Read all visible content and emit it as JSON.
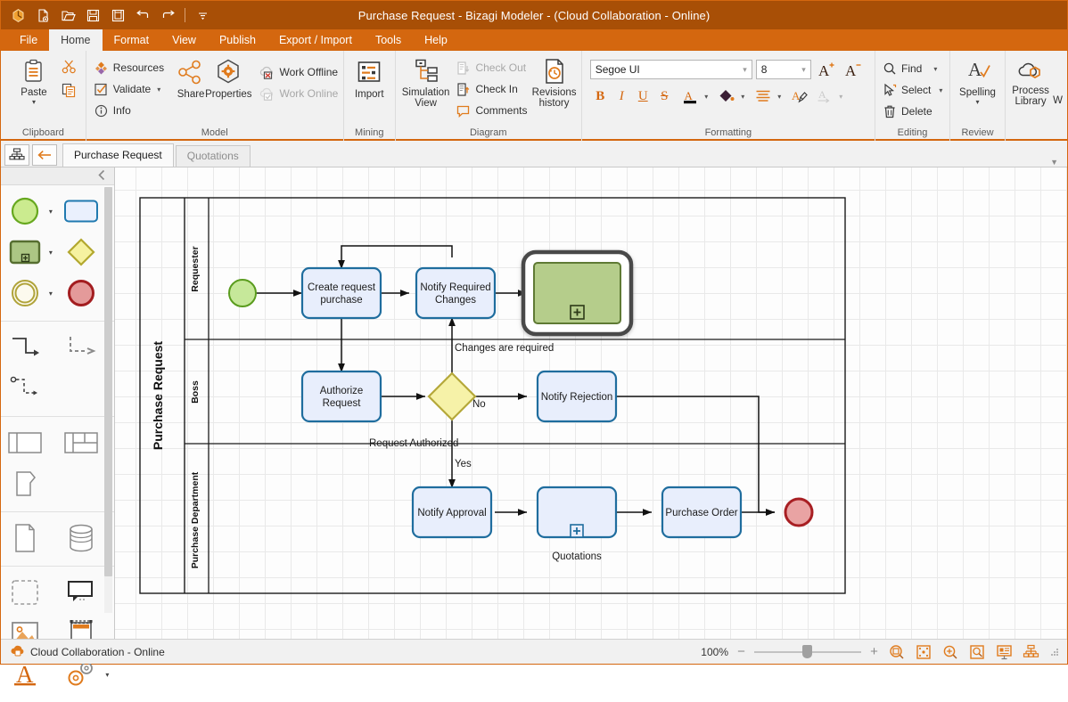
{
  "window": {
    "title": "Purchase Request - Bizagi Modeler - (Cloud Collaboration - Online)"
  },
  "quick_access": [
    {
      "name": "app-logo-icon",
      "tip": "Bizagi"
    },
    {
      "name": "new-document-icon",
      "tip": "New"
    },
    {
      "name": "open-folder-icon",
      "tip": "Open"
    },
    {
      "name": "save-icon",
      "tip": "Save"
    },
    {
      "name": "save-as-icon",
      "tip": "Save As"
    },
    {
      "name": "undo-icon",
      "tip": "Undo"
    },
    {
      "name": "redo-icon",
      "tip": "Redo"
    },
    {
      "name": "customize-qat-icon",
      "tip": "Customize Quick Access Toolbar"
    }
  ],
  "menu": {
    "tabs": [
      {
        "label": "File",
        "active": false
      },
      {
        "label": "Home",
        "active": true
      },
      {
        "label": "Format",
        "active": false
      },
      {
        "label": "View",
        "active": false
      },
      {
        "label": "Publish",
        "active": false
      },
      {
        "label": "Export / Import",
        "active": false
      },
      {
        "label": "Tools",
        "active": false
      },
      {
        "label": "Help",
        "active": false
      }
    ]
  },
  "ribbon": {
    "groups": {
      "clipboard": {
        "title": "Clipboard",
        "paste": "Paste",
        "cut": "Cut",
        "copy": "Copy"
      },
      "model": {
        "title": "Model",
        "resources": "Resources",
        "validate": "Validate",
        "info": "Info",
        "share": "Share",
        "properties": "Properties",
        "work_offline": "Work Offline",
        "work_online": "Work Online"
      },
      "mining": {
        "title": "Mining",
        "import": "Import"
      },
      "diagram": {
        "title": "Diagram",
        "simulation_view": "Simulation\nView",
        "simulation_view_line1": "Simulation",
        "simulation_view_line2": "View",
        "check_out": "Check Out",
        "check_in": "Check In",
        "comments": "Comments",
        "revisions_line1": "Revisions",
        "revisions_line2": "history"
      },
      "formatting": {
        "title": "Formatting",
        "font_family_value": "Segoe UI",
        "font_size_value": "8",
        "grow_font": "Increase font size",
        "shrink_font": "Decrease font size",
        "bold": "B",
        "italic": "I",
        "underline": "U",
        "strikethrough": "S",
        "font_color": "Font color",
        "fill_color": "Fill color",
        "align": "Align",
        "format_painter": "Format painter",
        "clear_format": "Clear format"
      },
      "editing": {
        "title": "Editing",
        "find": "Find",
        "select": "Select",
        "delete": "Delete"
      },
      "review": {
        "title": "Review",
        "spelling": "Spelling"
      },
      "collaboration": {
        "process_library_line1": "Process",
        "process_library_line2": "Library",
        "truncated": "W"
      }
    }
  },
  "document_tabs": {
    "diagram_selector_icon": "org-chart-icon",
    "back_icon": "back-arrow-icon",
    "tabs": [
      {
        "label": "Purchase Request",
        "active": true
      },
      {
        "label": "Quotations",
        "active": false
      }
    ]
  },
  "palette": {
    "collapse_icon": "chevron-left-icon",
    "items": [
      {
        "name": "start-event-shape",
        "label": "Start event",
        "has_dropdown": true
      },
      {
        "name": "task-shape",
        "label": "Task",
        "has_dropdown": true
      },
      {
        "name": "subprocess-shape",
        "label": "Sub-process",
        "has_dropdown": true
      },
      {
        "name": "gateway-shape",
        "label": "Gateway",
        "has_dropdown": true
      },
      {
        "name": "intermediate-event-shape",
        "label": "Intermediate event",
        "has_dropdown": true
      },
      {
        "name": "end-event-shape",
        "label": "End event",
        "has_dropdown": true
      },
      {
        "name": "sequence-flow-connector",
        "label": "Sequence flow",
        "has_dropdown": false
      },
      {
        "name": "message-flow-connector",
        "label": "Message flow",
        "has_dropdown": false
      },
      {
        "name": "association-connector",
        "label": "Association",
        "has_dropdown": false
      },
      {
        "name": "pool-shape",
        "label": "Pool",
        "has_dropdown": false
      },
      {
        "name": "lane-shape",
        "label": "Lane",
        "has_dropdown": false
      },
      {
        "name": "milestone-shape",
        "label": "Milestone",
        "has_dropdown": false
      },
      {
        "name": "data-object-shape",
        "label": "Data object",
        "has_dropdown": false
      },
      {
        "name": "data-store-shape",
        "label": "Data store",
        "has_dropdown": false
      },
      {
        "name": "group-shape",
        "label": "Group",
        "has_dropdown": false
      },
      {
        "name": "annotation-shape",
        "label": "Annotation",
        "has_dropdown": false
      },
      {
        "name": "image-shape",
        "label": "Image",
        "has_dropdown": false
      },
      {
        "name": "artifact-shape",
        "label": "Artifact",
        "has_dropdown": false
      },
      {
        "name": "text-tool",
        "label": "Text",
        "has_dropdown": false
      },
      {
        "name": "custom-artifacts-tool",
        "label": "Custom artifacts",
        "has_dropdown": true
      }
    ]
  },
  "diagram": {
    "pool": {
      "name": "Purchase Request"
    },
    "lanes": [
      {
        "name": "Requester"
      },
      {
        "name": "Boss"
      },
      {
        "name": "Purchase Department"
      }
    ],
    "nodes": [
      {
        "id": "start",
        "type": "start-event",
        "label": "",
        "lane": "Requester"
      },
      {
        "id": "create_request",
        "type": "task",
        "label": "Create request purchase",
        "label_line1": "Create request",
        "label_line2": "purchase",
        "lane": "Requester"
      },
      {
        "id": "notify_changes",
        "type": "task",
        "label": "Notify Required Changes",
        "label_line1": "Notify Required",
        "label_line2": "Changes",
        "lane": "Requester"
      },
      {
        "id": "selected_subprocess",
        "type": "sub-process",
        "label": "",
        "lane": "Requester",
        "selected": true
      },
      {
        "id": "authorize_request",
        "type": "task",
        "label": "Authorize Request",
        "label_line1": "Authorize",
        "label_line2": "Request",
        "lane": "Boss"
      },
      {
        "id": "gateway",
        "type": "exclusive-gateway",
        "label": "",
        "lane": "Boss"
      },
      {
        "id": "notify_rejection",
        "type": "task",
        "label": "Notify Rejection",
        "lane": "Boss"
      },
      {
        "id": "notify_approval",
        "type": "task",
        "label": "Notify Approval",
        "lane": "Purchase Department"
      },
      {
        "id": "quotations",
        "type": "sub-process",
        "label": "Quotations",
        "lane": "Purchase Department"
      },
      {
        "id": "purchase_order",
        "type": "task",
        "label": "Purchase Order",
        "lane": "Purchase Department"
      },
      {
        "id": "end",
        "type": "end-event",
        "label": "",
        "lane": "Purchase Department"
      }
    ],
    "flow_labels": {
      "changes_required": "Changes are required",
      "no": "No",
      "request_authorized": "Request Authorized",
      "yes": "Yes"
    },
    "colors": {
      "task_fill": "#e8eefc",
      "task_stroke": "#1f6d9e",
      "start_fill": "#c6e89a",
      "start_stroke": "#5a9c1e",
      "end_fill": "#e9a3a3",
      "end_stroke": "#a81f23",
      "gateway_fill": "#f6f2a8",
      "gateway_stroke": "#b5a83a",
      "subprocess_fill": "#b5cd8b",
      "subprocess_stroke": "#5f7a34",
      "selection": "#4a4a4a"
    }
  },
  "statusbar": {
    "collaboration_icon": "cloud-lock-icon",
    "collaboration_text": "Cloud Collaboration - Online",
    "zoom_level": "100%",
    "zoom_out": "−",
    "zoom_in": "+",
    "buttons": [
      {
        "name": "zoom-to-selection-button"
      },
      {
        "name": "fit-to-page-button"
      },
      {
        "name": "zoom-in-tool-button"
      },
      {
        "name": "zoom-region-button"
      },
      {
        "name": "presentation-view-button"
      },
      {
        "name": "process-tree-view-button"
      }
    ]
  }
}
